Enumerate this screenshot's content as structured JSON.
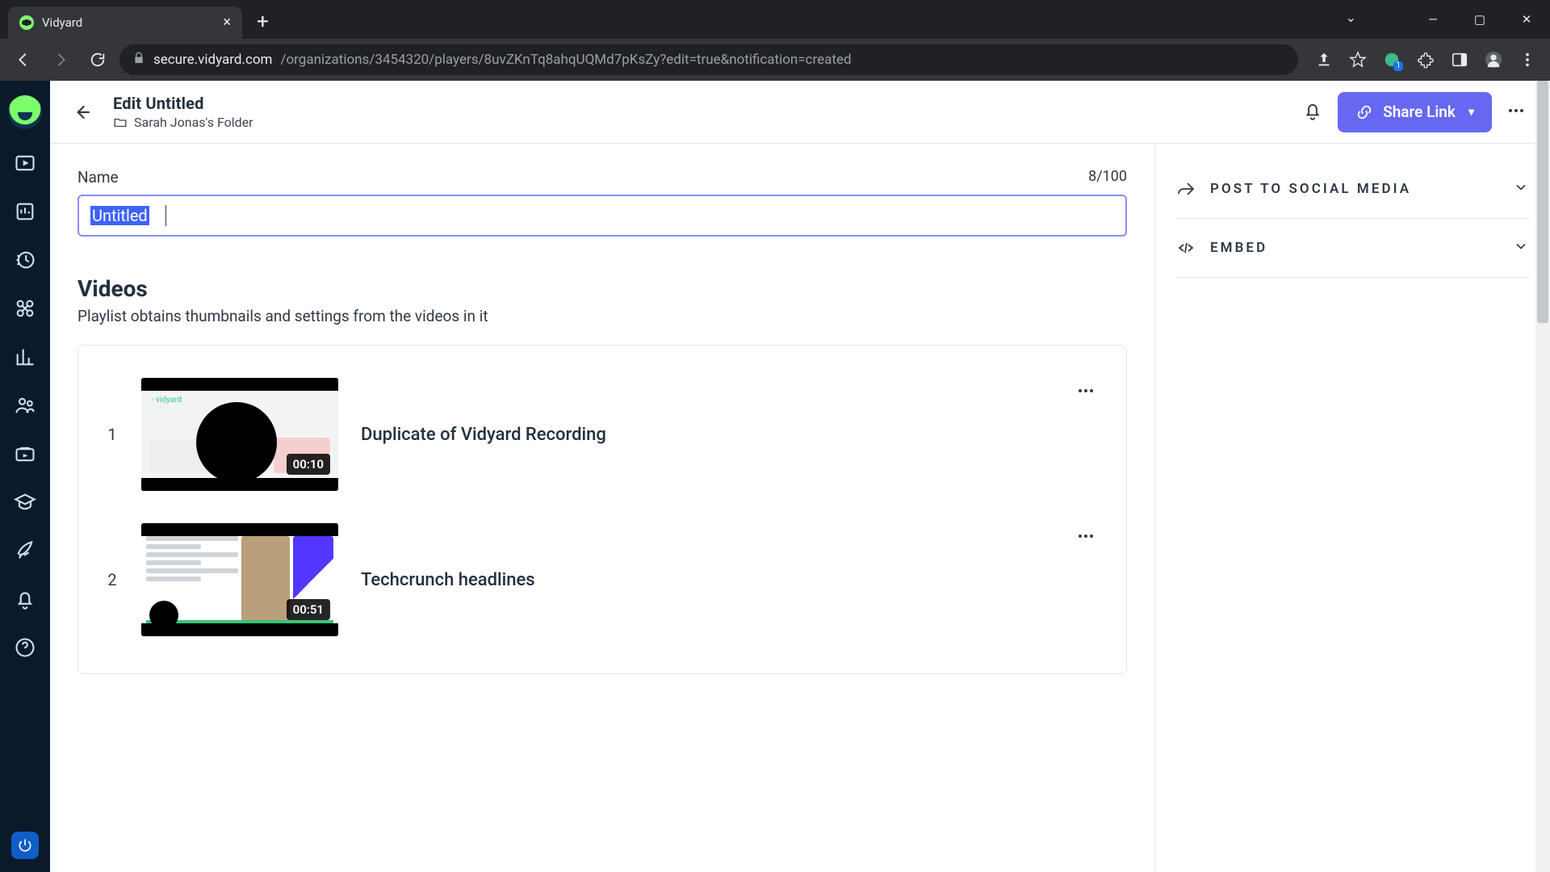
{
  "browser": {
    "tab_title": "Vidyard",
    "url_host": "secure.vidyard.com",
    "url_path": "/organizations/3454320/players/8uvZKnTq8ahqUQMd7pKsZy?edit=true&notification=created",
    "extension_badge": "1"
  },
  "header": {
    "title": "Edit Untitled",
    "folder": "Sarah Jonas's Folder",
    "share_label": "Share Link"
  },
  "name_field": {
    "label": "Name",
    "value": "Untitled",
    "counter": "8/100"
  },
  "videos_section": {
    "heading": "Videos",
    "subheading": "Playlist obtains thumbnails and settings from the videos in it",
    "items": [
      {
        "index": "1",
        "title": "Duplicate of Vidyard Recording",
        "duration": "00:10"
      },
      {
        "index": "2",
        "title": "Techcrunch headlines",
        "duration": "00:51"
      }
    ]
  },
  "side_panel": {
    "social_label": "POST TO SOCIAL MEDIA",
    "embed_label": "EMBED"
  }
}
